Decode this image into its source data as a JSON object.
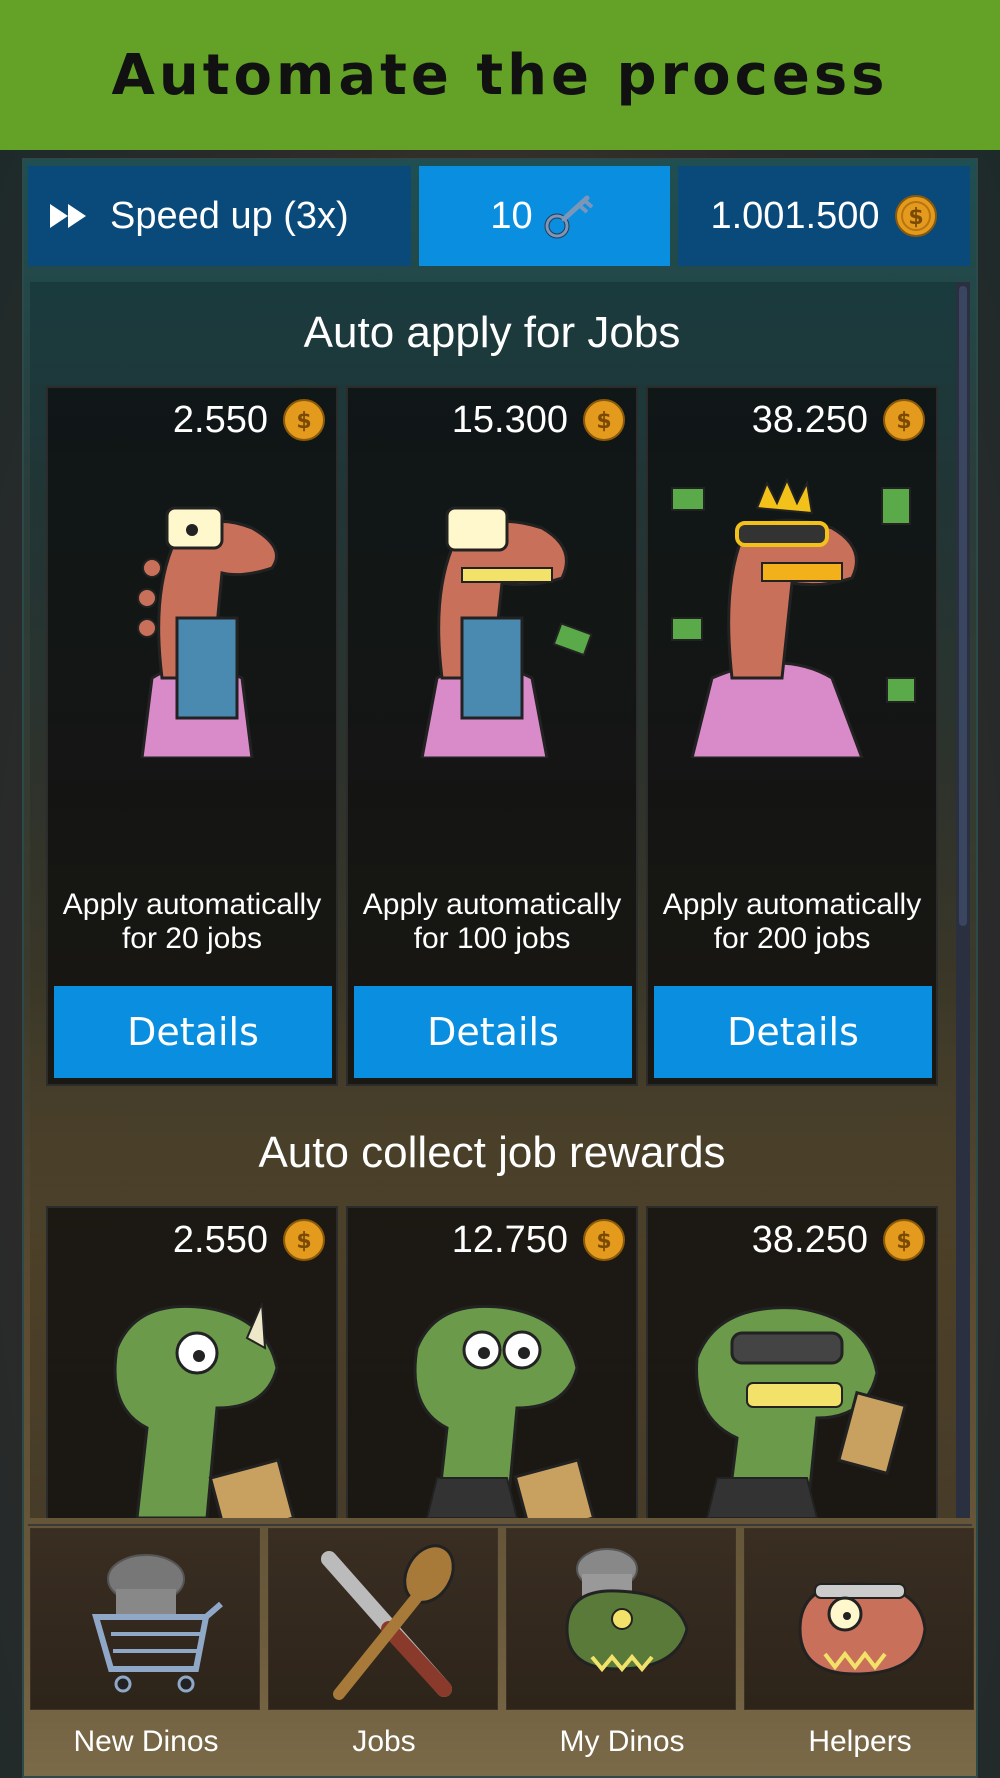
{
  "banner": {
    "title": "Automate the process"
  },
  "topbar": {
    "speed_label": "Speed up (3x)",
    "keys_count": "10",
    "coins_amount": "1.001.500"
  },
  "sections": [
    {
      "title": "Auto apply for Jobs",
      "cards": [
        {
          "price": "2.550",
          "desc_line1": "Apply automatically",
          "desc_line2": "for 20 jobs",
          "button": "Details"
        },
        {
          "price": "15.300",
          "desc_line1": "Apply automatically",
          "desc_line2": "for 100 jobs",
          "button": "Details"
        },
        {
          "price": "38.250",
          "desc_line1": "Apply automatically",
          "desc_line2": "for 200 jobs",
          "button": "Details"
        }
      ]
    },
    {
      "title": "Auto collect job rewards",
      "cards": [
        {
          "price": "2.550"
        },
        {
          "price": "12.750"
        },
        {
          "price": "38.250"
        }
      ]
    }
  ],
  "nav": [
    {
      "label": "New Dinos",
      "icon": "shopping-cart-icon"
    },
    {
      "label": "Jobs",
      "icon": "knife-spoon-icon"
    },
    {
      "label": "My Dinos",
      "icon": "dino-chef-icon"
    },
    {
      "label": "Helpers",
      "icon": "dino-helper-icon"
    }
  ],
  "colors": {
    "banner": "#63a127",
    "button_blue": "#0a8ee0",
    "dark_blue": "#0a4a7a",
    "coin": "#e49a1c"
  }
}
